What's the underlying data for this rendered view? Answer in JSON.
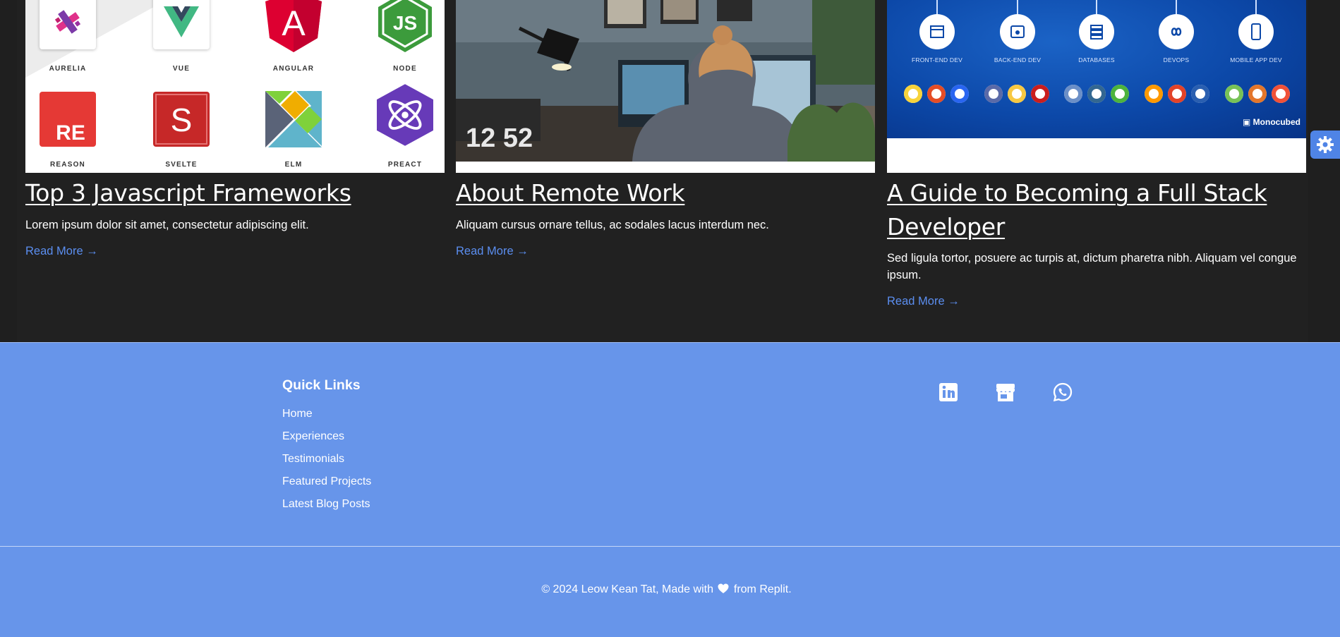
{
  "posts": [
    {
      "title": "Top 3 Javascript Frameworks",
      "description": "Lorem ipsum dolor sit amet, consectetur adipiscing elit.",
      "read_more": "Read More →",
      "thumb_labels": [
        "AURELIA",
        "VUE",
        "ANGULAR",
        "NODE",
        "REASON",
        "SVELTE",
        "ELM",
        "PREACT"
      ],
      "thumb_glyphs": {
        "vue": "V",
        "angular": "A",
        "node": "JS",
        "reason": "RE",
        "svelte": "S"
      }
    },
    {
      "title": "About Remote Work",
      "description": "Aliquam cursus ornare tellus, ac sodales lacus interdum nec.",
      "read_more": "Read More →",
      "clock": "12 52"
    },
    {
      "title": "A Guide to Becoming a Full Stack Developer",
      "description": "Sed ligula tortor, posuere ac turpis at, dictum pharetra nibh. Aliquam vel congue ipsum.",
      "read_more": "Read More →",
      "thumb_labels": [
        "FRONT-END DEV",
        "BACK-END DEV",
        "DATABASES",
        "DEVOPS",
        "MOBILE APP DEV"
      ],
      "brand": "Monocubed"
    }
  ],
  "footer": {
    "quick_links_title": "Quick Links",
    "quick_links": [
      "Home",
      "Experiences",
      "Testimonials",
      "Featured Projects",
      "Latest Blog Posts"
    ],
    "social_icons": [
      "linkedin-icon",
      "store-icon",
      "whatsapp-icon"
    ],
    "copyright_prefix": "© 2024 Leow Kean Tat, Made with",
    "copyright_suffix": "from Replit."
  },
  "colors": {
    "background": "#1f1f1f",
    "link": "#5b8ef0",
    "footer": "#6795ea",
    "fab": "#4f84e6"
  }
}
